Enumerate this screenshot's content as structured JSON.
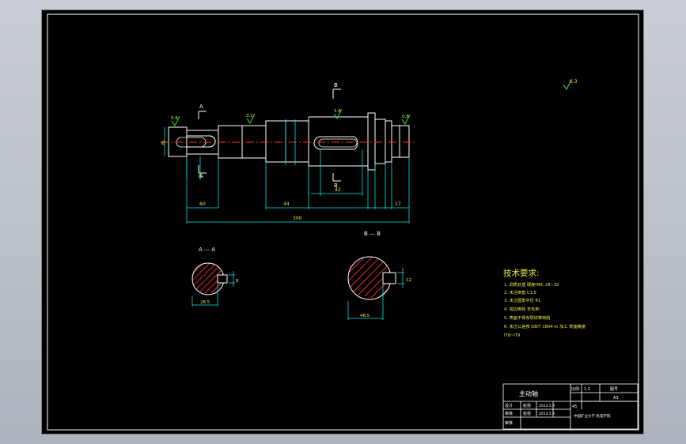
{
  "colors": {
    "background": "#000000",
    "outline": "#ffffff",
    "dimension": "#00e5e5",
    "center_line": "#ff2a2a",
    "hatch": "#ff2a2a",
    "text_yellow": "#e8e84a",
    "symbol_green": "#38e038"
  },
  "section_markers": {
    "a_top": "A",
    "a_bottom": "A",
    "b_top": "B",
    "b_bottom": "B"
  },
  "roughness": {
    "r1": "0.8",
    "r2": "3.2",
    "r3": "1.6",
    "r4": "0.8",
    "general": "6.3"
  },
  "dimensions": {
    "d_left_end": "Ø",
    "d_key_a": "8",
    "d_seg1": "60",
    "d_seg2": "44",
    "d_key_b": "42",
    "d_total": "300",
    "d_seg_r": "17"
  },
  "sections": {
    "aa_title": "A — A",
    "bb_title": "B — B",
    "aa_width": "8",
    "aa_depth": "28.5",
    "bb_width": "12",
    "bb_depth": "48.5"
  },
  "tech_req": {
    "title": "技术要求:",
    "lines": [
      "1. 调质处理 硬度HRC 28~32",
      "2. 未注倒角 C1.5",
      "3. 未注圆角半径 R1",
      "4. 锐边倒钝 去毛刺",
      "5. 表面不得有裂纹等缺陷",
      "6. 未注公差按 GB/T 1804-m 加工 表面精度",
      "  IT8~IT9"
    ]
  },
  "title_block": {
    "part_name": "主动轴",
    "scale_label": "比例",
    "scale_value": "1:1",
    "drawing_no_label": "图号",
    "sheet": "A3",
    "material": "45",
    "designer_label": "设计",
    "designer": "赵昆",
    "design_date": "2014.5.9",
    "checker_label": "审核",
    "checker": "赵昆",
    "check_date": "2014.5.9",
    "approve_label": "审核",
    "school": "中国矿业大学 机电学院"
  }
}
